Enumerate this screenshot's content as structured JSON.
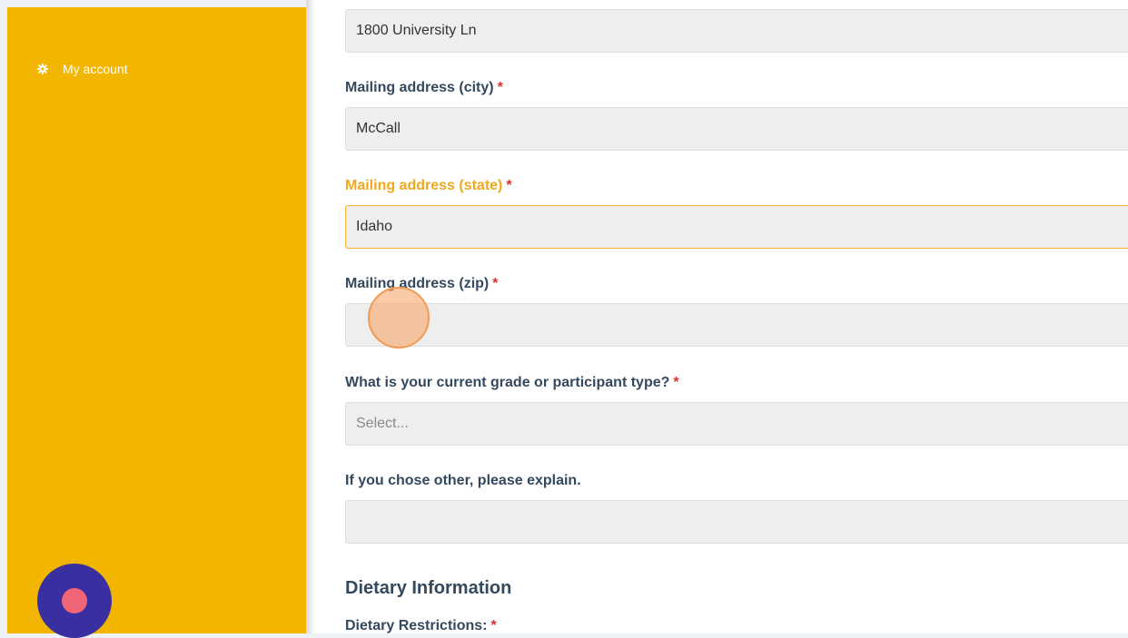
{
  "sidebar": {
    "items": [
      {
        "label": "My account",
        "icon": "gear-icon"
      }
    ],
    "background": "#f2b600"
  },
  "form": {
    "street": {
      "value": "1800 University Ln"
    },
    "city": {
      "label": "Mailing address (city)",
      "value": "McCall",
      "required_mark": "*"
    },
    "state": {
      "label": "Mailing address (state)",
      "value": "Idaho",
      "required_mark": "*"
    },
    "zip": {
      "label": "Mailing address (zip)",
      "value": "",
      "required_mark": "*"
    },
    "grade": {
      "label": "What is your current grade or participant type?",
      "placeholder": "Select...",
      "required_mark": "*"
    },
    "other": {
      "label": "If you chose other, please explain.",
      "value": ""
    }
  },
  "dietary": {
    "section_title": "Dietary Information",
    "restrictions_label": "Dietary Restrictions:",
    "required_mark": "*"
  },
  "colors": {
    "accent": "#f0a91e",
    "heading": "#34495e",
    "required": "#e03131",
    "help_button": "#3a2fa0"
  }
}
